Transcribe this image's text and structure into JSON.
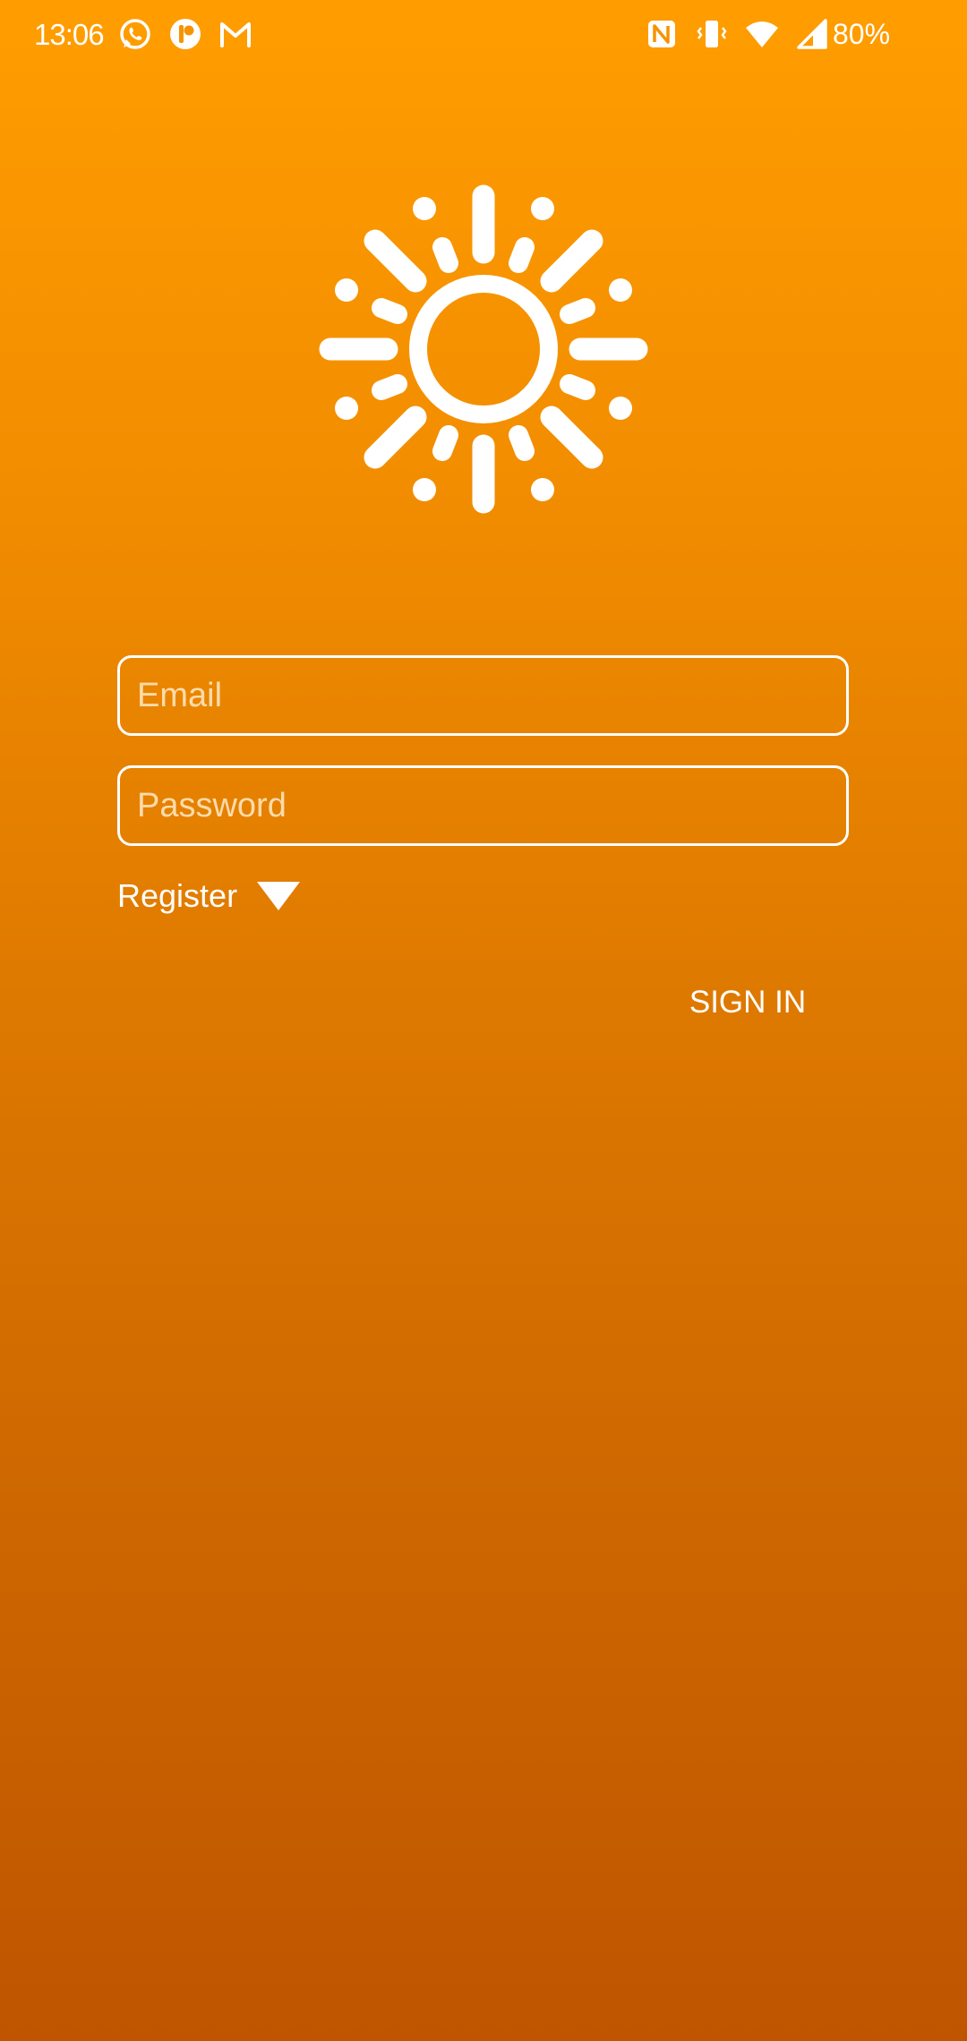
{
  "status_bar": {
    "time": "13:06",
    "left_icons": [
      "whatsapp-icon",
      "pinterest-like-icon",
      "gmail-icon"
    ],
    "right_icons": [
      "nfc-icon",
      "vibrate-icon",
      "wifi-icon",
      "cell-signal-icon"
    ],
    "battery": "80%"
  },
  "logo": {
    "icon": "sun-icon"
  },
  "form": {
    "email_placeholder": "Email",
    "email_value": "",
    "password_placeholder": "Password",
    "password_value": "",
    "register_label": "Register",
    "register_icon": "caret-down-icon",
    "sign_in_label": "SIGN IN"
  },
  "colors": {
    "gradient_top": "#ff9d00",
    "gradient_bottom": "#bf5500",
    "foreground": "#ffffff"
  }
}
